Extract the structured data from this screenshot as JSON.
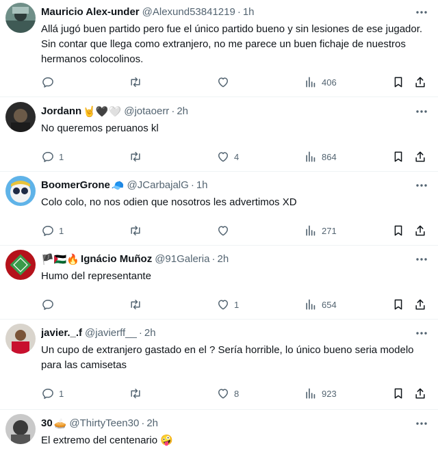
{
  "colors": {
    "text": "#0f1419",
    "secondary": "#536471",
    "divider": "#eff3f4"
  },
  "separator": "·",
  "tweets": [
    {
      "name": "Mauricio Alex-under",
      "emojis": "",
      "handle": "@Alexund53841219",
      "time": "1h",
      "text": "Allá jugó buen partido pero fue el único partido bueno y sin lesiones de ese jugador. Sin contar que llega como extranjero, no me parece un buen fichaje de nuestros hermanos colocolinos.",
      "reply_count": "",
      "retweet_count": "",
      "like_count": "",
      "views": "406",
      "avatar_icon": "profile-photo"
    },
    {
      "name": "Jordann",
      "emojis": "🤘🖤🤍",
      "handle": "@jotaoerr",
      "time": "2h",
      "text": "No queremos peruanos kl",
      "reply_count": "1",
      "retweet_count": "",
      "like_count": "4",
      "views": "864",
      "avatar_icon": "profile-photo"
    },
    {
      "name": "BoomerGrone",
      "emojis": "🧢",
      "handle": "@JCarbajalG",
      "time": "1h",
      "text": "Colo colo, no nos odien que nosotros les advertimos XD",
      "reply_count": "1",
      "retweet_count": "",
      "like_count": "",
      "views": "271",
      "avatar_icon": "cartoon-avatar"
    },
    {
      "name": "Ignácio Muñoz",
      "emojis_before": "🏴🇵🇸🔥",
      "handle": "@91Galeria",
      "time": "2h",
      "text": "Humo del representante",
      "reply_count": "",
      "retweet_count": "",
      "like_count": "1",
      "views": "654",
      "avatar_icon": "field-logo"
    },
    {
      "name": "javier._.f",
      "emojis": "",
      "handle": "@javierff__",
      "time": "2h",
      "text": "Un cupo de extranjero gastado en el ? Sería horrible, lo único bueno seria modelo para las camisetas",
      "reply_count": "1",
      "retweet_count": "",
      "like_count": "8",
      "views": "923",
      "avatar_icon": "profile-photo"
    },
    {
      "name": "30",
      "emojis": "🥧",
      "handle": "@ThirtyTeen30",
      "time": "2h",
      "text": "El extremo del centenario 🤪",
      "avatar_icon": "profile-photo"
    }
  ]
}
